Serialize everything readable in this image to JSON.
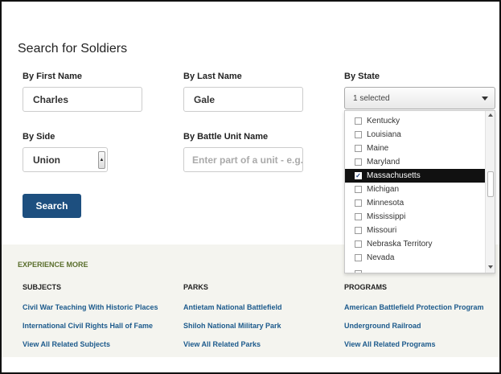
{
  "form": {
    "title": "Search for Soldiers",
    "first_name_label": "By First Name",
    "first_name_value": "Charles",
    "last_name_label": "By Last Name",
    "last_name_value": "Gale",
    "state_label": "By State",
    "state_value": "1 selected",
    "side_label": "By Side",
    "side_value": "Union",
    "battle_unit_label": "By Battle Unit Name",
    "battle_unit_placeholder": "Enter part of a unit - e.g.",
    "search_label": "Search"
  },
  "state_options": [
    {
      "label": "Kentucky",
      "checked": false
    },
    {
      "label": "Louisiana",
      "checked": false
    },
    {
      "label": "Maine",
      "checked": false
    },
    {
      "label": "Maryland",
      "checked": false
    },
    {
      "label": "Massachusetts",
      "checked": true
    },
    {
      "label": "Michigan",
      "checked": false
    },
    {
      "label": "Minnesota",
      "checked": false
    },
    {
      "label": "Mississippi",
      "checked": false
    },
    {
      "label": "Missouri",
      "checked": false
    },
    {
      "label": "Nebraska Territory",
      "checked": false
    },
    {
      "label": "Nevada",
      "checked": false
    }
  ],
  "experience": {
    "heading": "EXPERIENCE MORE",
    "subjects": {
      "heading": "SUBJECTS",
      "links": [
        "Civil War Teaching With Historic Places",
        "International Civil Rights Hall of Fame",
        "View All Related Subjects"
      ]
    },
    "parks": {
      "heading": "PARKS",
      "links": [
        "Antietam National Battlefield",
        "Shiloh National Military Park",
        "View All Related Parks"
      ]
    },
    "programs": {
      "heading": "PROGRAMS",
      "links": [
        "American Battlefield Protection Program",
        "Underground Railroad",
        "View All Related Programs"
      ]
    }
  },
  "colors": {
    "button": "#1d4f7f",
    "link": "#1c5a8c",
    "experience_heading": "#5a6e2c",
    "experience_bg": "#f4f4ef"
  },
  "icons": {
    "side_select": "spinner-arrow-icon",
    "state_select": "caret-down-icon",
    "checked": "checkmark-icon"
  }
}
